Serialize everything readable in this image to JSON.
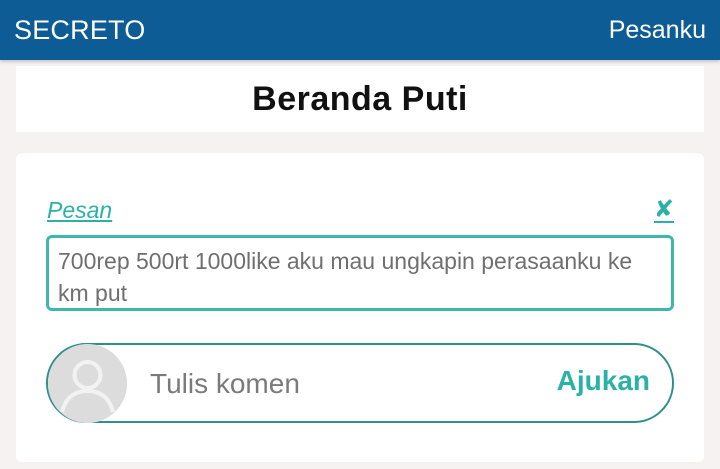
{
  "header": {
    "brand": "SECRETO",
    "nav_link": "Pesanku",
    "background_color": "#0d5c96"
  },
  "title_card": {
    "title": "Beranda Puti"
  },
  "message_card": {
    "label": "Pesan",
    "close_symbol": "✘",
    "message_text": "700rep 500rt 1000like aku mau ungkapin perasaanku ke km put",
    "accent_color": "#2ab2a6"
  },
  "comment": {
    "placeholder": "Tulis komen",
    "submit_label": "Ajukan",
    "avatar_icon": "default-user-avatar"
  }
}
